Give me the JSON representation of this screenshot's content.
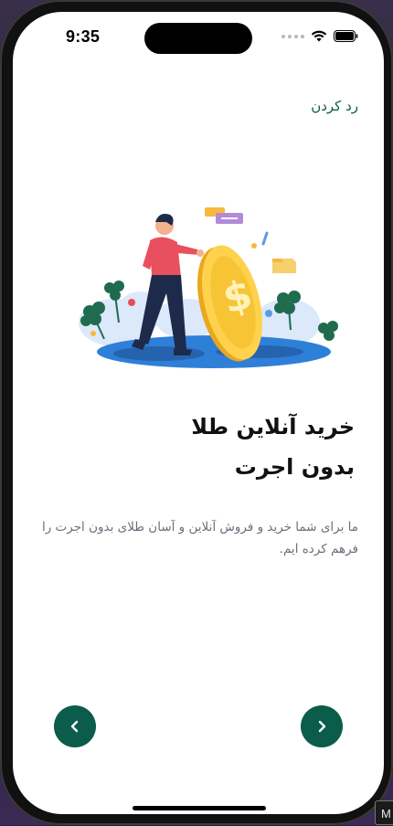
{
  "status_bar": {
    "time": "9:35",
    "icons": [
      "signal-dots-icon",
      "wifi-icon",
      "battery-icon"
    ]
  },
  "onboarding": {
    "skip_label": "رد کردن",
    "illustration": "person-pushing-gold-coin-illustration",
    "title_line1": "خرید آنلاین طلا",
    "title_line2": "بدون اجرت",
    "description": "ما برای شما خرید و فروش آنلاین و آسان طلای بدون اجرت را فرهم کرده ایم.",
    "prev_icon": "chevron-left-icon",
    "next_icon": "chevron-right-icon"
  },
  "colors": {
    "accent": "#0b5c4a",
    "text_primary": "#111111",
    "text_secondary": "#6b6f7a",
    "background": "#ffffff"
  },
  "corner_chip": {
    "label": "M"
  }
}
